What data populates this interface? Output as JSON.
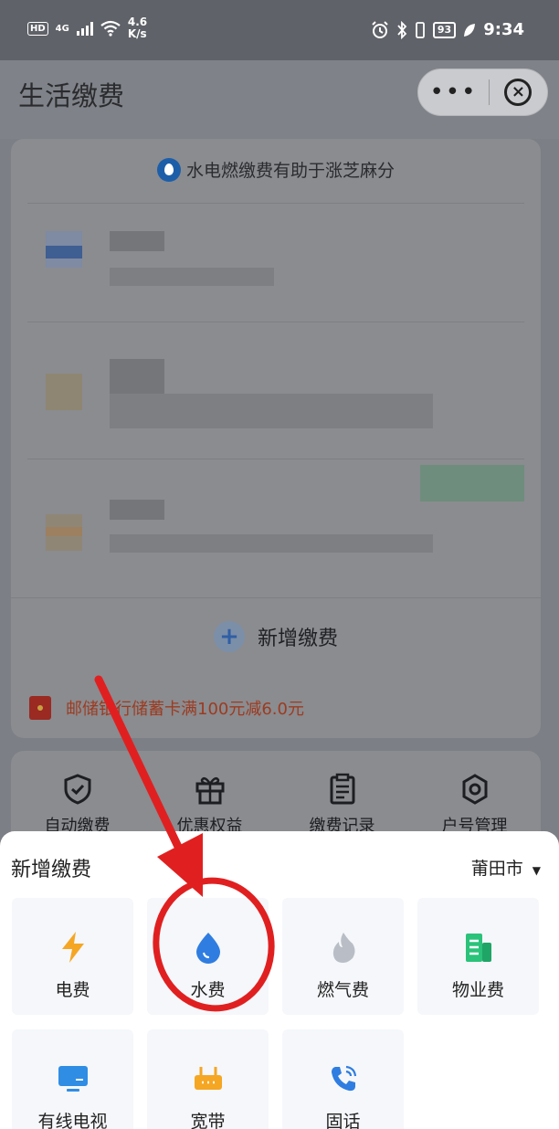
{
  "status_bar": {
    "hd": "HD",
    "network": "4G",
    "speed_value": "4.6",
    "speed_unit": "K/s",
    "battery": "93",
    "time": "9:34"
  },
  "header": {
    "title": "生活缴费",
    "more": "•••",
    "close": "×"
  },
  "card": {
    "tip": "水电燃缴费有助于涨芝麻分",
    "add_label": "新增缴费",
    "promo": "邮储银行储蓄卡满100元减6.0元"
  },
  "quick_actions": [
    {
      "label": "自动缴费",
      "icon": "shield-check-icon"
    },
    {
      "label": "优惠权益",
      "icon": "gift-icon"
    },
    {
      "label": "缴费记录",
      "icon": "clipboard-icon"
    },
    {
      "label": "户号管理",
      "icon": "gear-icon"
    }
  ],
  "sheet": {
    "title": "新增缴费",
    "city": "莆田市",
    "city_caret": "▼",
    "tiles": [
      {
        "label": "电费",
        "icon": "lightning-icon",
        "color": "#f5a623"
      },
      {
        "label": "水费",
        "icon": "water-drop-icon",
        "color": "#2f7de1"
      },
      {
        "label": "燃气费",
        "icon": "flame-icon",
        "color": "#b9bec6"
      },
      {
        "label": "物业费",
        "icon": "building-icon",
        "color": "#2bc27a"
      },
      {
        "label": "有线电视",
        "icon": "tv-icon",
        "color": "#2f8de4"
      },
      {
        "label": "宽带",
        "icon": "router-icon",
        "color": "#f5a623"
      },
      {
        "label": "固话",
        "icon": "phone-icon",
        "color": "#2f7de1"
      }
    ]
  },
  "colors": {
    "accent_blue": "#2f7de1",
    "annotation_red": "#e02020",
    "promo_text": "#9c3b20"
  }
}
